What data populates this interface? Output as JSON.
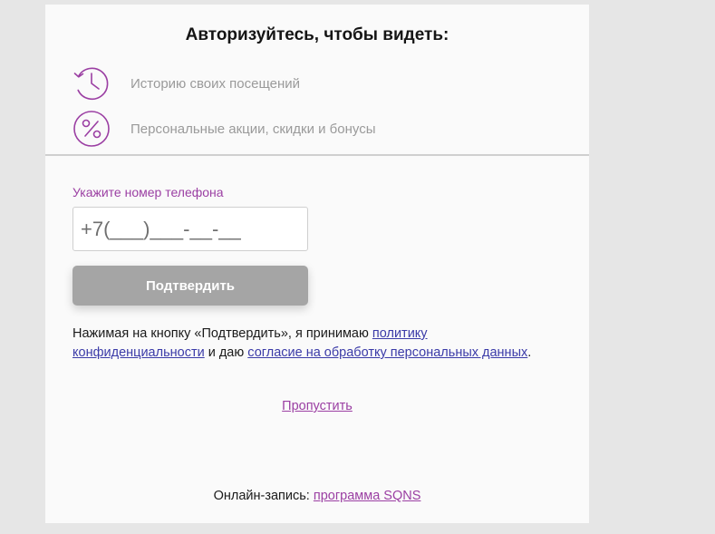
{
  "header": {
    "title": "Авторизуйтесь, чтобы видеть:"
  },
  "benefits": [
    {
      "icon": "history-clock-icon",
      "text": "Историю своих посещений"
    },
    {
      "icon": "percent-icon",
      "text": "Персональные акции, скидки и бонусы"
    }
  ],
  "form": {
    "phone_label": "Укажите номер телефона",
    "phone_placeholder": "+7(___)___-__-__",
    "confirm_label": "Подтвердить"
  },
  "consent": {
    "text_before": "Нажимая на кнопку «Подтвердить», я принимаю ",
    "privacy_link": "политику конфиденциальности",
    "text_middle": " и даю ",
    "data_link": "согласие на обработку персональных данных",
    "text_after": "."
  },
  "skip_label": "Пропустить",
  "footer": {
    "prefix": "Онлайн-запись: ",
    "link": "программа SQNS"
  },
  "colors": {
    "accent": "#9b3fa3",
    "link": "#3b3ba8",
    "button": "#a5a5a5"
  }
}
